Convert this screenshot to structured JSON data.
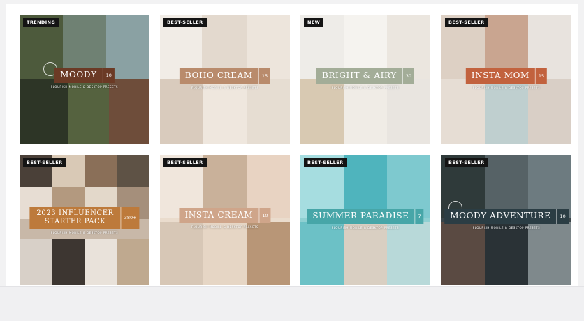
{
  "grid": {
    "cards": [
      {
        "badge": "TRENDING",
        "title": "MOODY",
        "count": "10",
        "subtitle": "FLOURISH MOBILE & DESKTOP PRESETS",
        "banner_color": "#6b3a25"
      },
      {
        "badge": "BEST-SELLER",
        "title": "BOHO CREAM",
        "count": "15",
        "subtitle": "FLOURISH MOBILE & DESKTOP PRESETS",
        "banner_color": "#b98b6c"
      },
      {
        "badge": "NEW",
        "title": "BRIGHT & AIRY",
        "count": "30",
        "subtitle": "FLOURISH MOBILE & DESKTOP PRESETS",
        "banner_color": "#a3ad98"
      },
      {
        "badge": "BEST-SELLER",
        "title": "INSTA MOM",
        "count": "15",
        "subtitle": "FLOURISH MOBILE & DESKTOP PRESETS",
        "banner_color": "#c2623e"
      },
      {
        "badge": "BEST-SELLER",
        "title_line1": "2023 INFLUENCER",
        "title_line2": "STARTER PACK",
        "count": "380+",
        "subtitle": "FLOURISH MOBILE & DESKTOP PRESETS",
        "banner_color": "#bd7a3b"
      },
      {
        "badge": "BEST-SELLER",
        "title": "INSTA CREAM",
        "count": "10",
        "subtitle": "FLOURISH MOBILE & DESKTOP PRESETS",
        "banner_color": "#cfa58a"
      },
      {
        "badge": "BEST-SELLER",
        "title": "SUMMER PARADISE",
        "count": "7",
        "subtitle": "FLOURISH MOBILE & DESKTOP PRESETS",
        "banner_color": "#47a6a8"
      },
      {
        "badge": "BEST-SELLER",
        "title": "MOODY ADVENTURE",
        "count": "10",
        "subtitle": "FLOURISH MOBILE & DESKTOP PRESETS",
        "banner_color": "#2b3d44"
      }
    ]
  }
}
